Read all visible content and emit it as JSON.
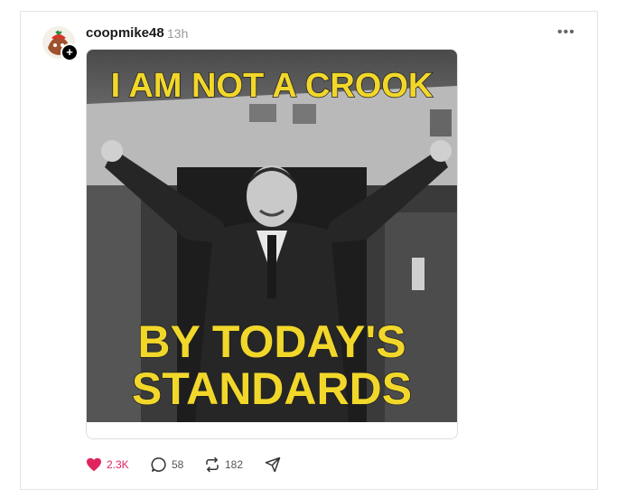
{
  "post": {
    "username": "coopmike48",
    "time": "13h",
    "more_label": "•••",
    "image": {
      "top_text": "I AM NOT A CROOK",
      "bottom_text_line1": "BY TODAY'S",
      "bottom_text_line2": "STANDARDS"
    },
    "actions": {
      "likes": "2.3K",
      "replies": "58",
      "reposts": "182"
    }
  },
  "colors": {
    "like_accent": "#e0245e",
    "meme_text": "#f2d72b"
  }
}
